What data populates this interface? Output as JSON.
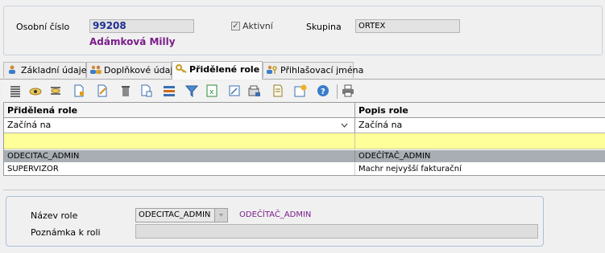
{
  "header": {
    "osobni_cislo_label": "Osobní číslo",
    "osobni_cislo_value": "99208",
    "person_name": "Adámková Milly",
    "aktivni_label": "Aktivní",
    "aktivni_checked": true,
    "skupina_label": "Skupina",
    "skupina_value": "ORTEX"
  },
  "tabs": [
    {
      "label": "Základní údaje",
      "icon": "person-icon"
    },
    {
      "label": "Doplňkové údaje",
      "icon": "persons-icon"
    },
    {
      "label": "Přidělené role",
      "icon": "keys-icon",
      "active": true
    },
    {
      "label": "Přihlašovací jména",
      "icon": "user-key-icon"
    }
  ],
  "toolbar_icons": [
    "list-icon",
    "view-icon",
    "hide-columns-icon",
    "new-icon",
    "edit-icon",
    "delete-icon",
    "copy-icon",
    "sort-icon",
    "filter-icon",
    "excel-icon",
    "edit-note-icon",
    "export-icon",
    "report-icon",
    "settings-icon",
    "help-icon",
    "print-icon"
  ],
  "grid": {
    "columns": [
      "Přidělená role",
      "Popis role"
    ],
    "filters": [
      "Začíná na",
      "Začíná na"
    ],
    "rows": [
      [
        "ODECITAC_ADMIN",
        "ODEČÍTAČ_ADMIN"
      ],
      [
        "SUPERVIZOR",
        "Machr nejvyšší fakturační"
      ]
    ]
  },
  "detail": {
    "nazev_role_label": "Název role",
    "nazev_role_value": "ODECITAC_ADMIN",
    "nazev_role_desc": "ODEČÍTAČ_ADMIN",
    "poznamka_label": "Poznámka k roli",
    "poznamka_value": ""
  },
  "colors": {
    "selected_row": "#a8aeb3",
    "filter_row": "#ffff99",
    "name_purple": "#7a1d8a",
    "number_blue": "#1f2f8f"
  }
}
